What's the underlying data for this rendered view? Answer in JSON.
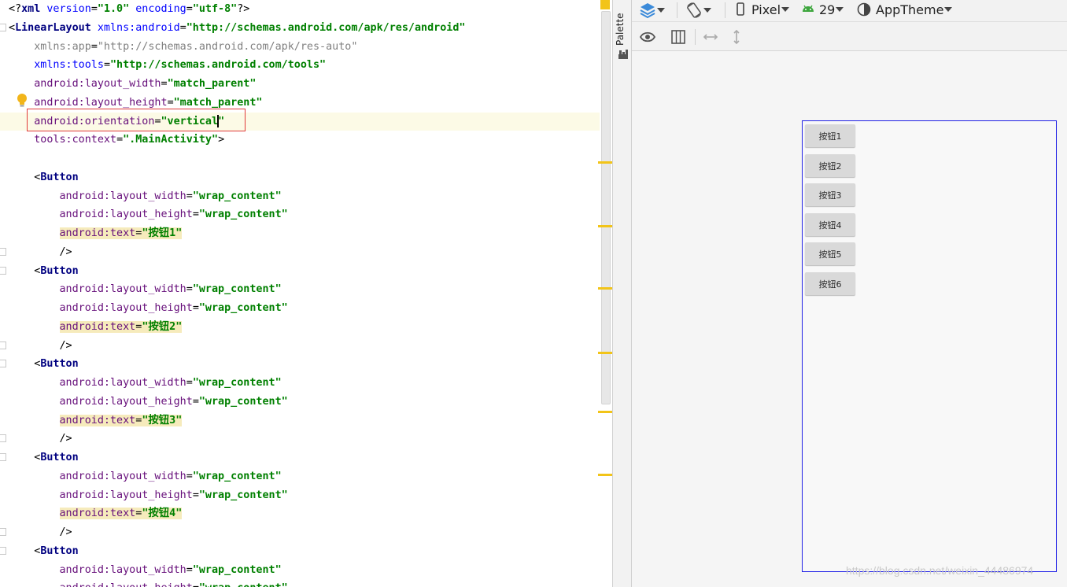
{
  "editor": {
    "lines": [
      {
        "parts": [
          [
            "punc",
            "<?"
          ],
          [
            "tag",
            "xml "
          ],
          [
            "attr-blue",
            "version"
          ],
          [
            "punc",
            "="
          ],
          [
            "val",
            "\"1.0\""
          ],
          [
            "punc",
            " "
          ],
          [
            "attr-blue",
            "encoding"
          ],
          [
            "punc",
            "="
          ],
          [
            "val",
            "\"utf-8\""
          ],
          [
            "punc",
            "?>"
          ]
        ]
      },
      {
        "parts": [
          [
            "punc",
            "<"
          ],
          [
            "tag",
            "LinearLayout "
          ],
          [
            "attr-blue",
            "xmlns:android"
          ],
          [
            "punc",
            "="
          ],
          [
            "val",
            "\"http://schemas.android.com/apk/res/android\""
          ]
        ]
      },
      {
        "parts": [
          [
            "punc",
            "    "
          ],
          [
            "attr-gray",
            "xmlns:app"
          ],
          [
            "punc",
            "="
          ],
          [
            "valg",
            "\"http://schemas.android.com/apk/res-auto\""
          ]
        ]
      },
      {
        "parts": [
          [
            "punc",
            "    "
          ],
          [
            "attr-blue",
            "xmlns:tools"
          ],
          [
            "punc",
            "="
          ],
          [
            "val",
            "\"http://schemas.android.com/tools\""
          ]
        ]
      },
      {
        "parts": [
          [
            "punc",
            "    "
          ],
          [
            "attr-ns",
            "android:layout_width"
          ],
          [
            "punc",
            "="
          ],
          [
            "val",
            "\"match_parent\""
          ]
        ]
      },
      {
        "parts": [
          [
            "punc",
            "    "
          ],
          [
            "attr-ns",
            "android:layout_height"
          ],
          [
            "punc",
            "="
          ],
          [
            "val",
            "\"match_parent\""
          ]
        ]
      },
      {
        "parts": [
          [
            "punc",
            "    "
          ],
          [
            "attr-ns",
            "android:orientation"
          ],
          [
            "punc",
            "="
          ],
          [
            "val",
            "\"vertical"
          ],
          [
            "caret",
            ""
          ],
          [
            "val",
            "\""
          ]
        ],
        "active": true
      },
      {
        "parts": [
          [
            "punc",
            "    "
          ],
          [
            "attr-ns",
            "tools:context"
          ],
          [
            "punc",
            "="
          ],
          [
            "val",
            "\".MainActivity\""
          ],
          [
            "punc",
            ">"
          ]
        ]
      },
      {
        "parts": []
      },
      {
        "parts": [
          [
            "punc",
            "    <"
          ],
          [
            "tag",
            "Button"
          ]
        ]
      },
      {
        "parts": [
          [
            "punc",
            "        "
          ],
          [
            "attr-ns",
            "android:layout_width"
          ],
          [
            "punc",
            "="
          ],
          [
            "val",
            "\"wrap_content\""
          ]
        ]
      },
      {
        "parts": [
          [
            "punc",
            "        "
          ],
          [
            "attr-ns",
            "android:layout_height"
          ],
          [
            "punc",
            "="
          ],
          [
            "val",
            "\"wrap_content\""
          ]
        ]
      },
      {
        "parts": [
          [
            "punc",
            "        "
          ],
          [
            "hl-attr",
            "android:text"
          ],
          [
            "hl-punc",
            "="
          ],
          [
            "hl-val",
            "\"按钮1\""
          ]
        ]
      },
      {
        "parts": [
          [
            "punc",
            "        />"
          ]
        ]
      },
      {
        "parts": [
          [
            "punc",
            "    <"
          ],
          [
            "tag",
            "Button"
          ]
        ]
      },
      {
        "parts": [
          [
            "punc",
            "        "
          ],
          [
            "attr-ns",
            "android:layout_width"
          ],
          [
            "punc",
            "="
          ],
          [
            "val",
            "\"wrap_content\""
          ]
        ]
      },
      {
        "parts": [
          [
            "punc",
            "        "
          ],
          [
            "attr-ns",
            "android:layout_height"
          ],
          [
            "punc",
            "="
          ],
          [
            "val",
            "\"wrap_content\""
          ]
        ]
      },
      {
        "parts": [
          [
            "punc",
            "        "
          ],
          [
            "hl-attr",
            "android:text"
          ],
          [
            "hl-punc",
            "="
          ],
          [
            "hl-val",
            "\"按钮2\""
          ]
        ]
      },
      {
        "parts": [
          [
            "punc",
            "        />"
          ]
        ]
      },
      {
        "parts": [
          [
            "punc",
            "    <"
          ],
          [
            "tag",
            "Button"
          ]
        ]
      },
      {
        "parts": [
          [
            "punc",
            "        "
          ],
          [
            "attr-ns",
            "android:layout_width"
          ],
          [
            "punc",
            "="
          ],
          [
            "val",
            "\"wrap_content\""
          ]
        ]
      },
      {
        "parts": [
          [
            "punc",
            "        "
          ],
          [
            "attr-ns",
            "android:layout_height"
          ],
          [
            "punc",
            "="
          ],
          [
            "val",
            "\"wrap_content\""
          ]
        ]
      },
      {
        "parts": [
          [
            "punc",
            "        "
          ],
          [
            "hl-attr",
            "android:text"
          ],
          [
            "hl-punc",
            "="
          ],
          [
            "hl-val",
            "\"按钮3\""
          ]
        ]
      },
      {
        "parts": [
          [
            "punc",
            "        />"
          ]
        ]
      },
      {
        "parts": [
          [
            "punc",
            "    <"
          ],
          [
            "tag",
            "Button"
          ]
        ]
      },
      {
        "parts": [
          [
            "punc",
            "        "
          ],
          [
            "attr-ns",
            "android:layout_width"
          ],
          [
            "punc",
            "="
          ],
          [
            "val",
            "\"wrap_content\""
          ]
        ]
      },
      {
        "parts": [
          [
            "punc",
            "        "
          ],
          [
            "attr-ns",
            "android:layout_height"
          ],
          [
            "punc",
            "="
          ],
          [
            "val",
            "\"wrap_content\""
          ]
        ]
      },
      {
        "parts": [
          [
            "punc",
            "        "
          ],
          [
            "hl-attr",
            "android:text"
          ],
          [
            "hl-punc",
            "="
          ],
          [
            "hl-val",
            "\"按钮4\""
          ]
        ]
      },
      {
        "parts": [
          [
            "punc",
            "        />"
          ]
        ]
      },
      {
        "parts": [
          [
            "punc",
            "    <"
          ],
          [
            "tag",
            "Button"
          ]
        ]
      },
      {
        "parts": [
          [
            "punc",
            "        "
          ],
          [
            "attr-ns",
            "android:layout_width"
          ],
          [
            "punc",
            "="
          ],
          [
            "val",
            "\"wrap_content\""
          ]
        ]
      },
      {
        "parts": [
          [
            "punc",
            "        "
          ],
          [
            "attr-ns",
            "android:layout_height"
          ],
          [
            "punc",
            "="
          ],
          [
            "val",
            "\"wrap_content\""
          ]
        ]
      }
    ]
  },
  "palette": {
    "label": "Palette",
    "icon": "palette-icon"
  },
  "toolbar": {
    "design_surface_icon": "layers-icon",
    "orientation_icon": "rotate-icon",
    "device_icon": "phone-icon",
    "device_label": "Pixel",
    "api_icon": "android-icon",
    "api_label": "29",
    "theme_icon": "theme-icon",
    "theme_label": "AppTheme",
    "view_options_icon": "eye-icon",
    "layout_icon": "columns-icon",
    "expand_h_icon": "expand-horizontal-icon",
    "expand_v_icon": "expand-vertical-icon"
  },
  "preview": {
    "buttons": [
      "按钮1",
      "按钮2",
      "按钮3",
      "按钮4",
      "按钮5",
      "按钮6"
    ]
  },
  "watermark": "https://blog.csdn.net/weixin_44486974",
  "colors": {
    "accent_frame": "#2020e6",
    "marker": "#f2c418",
    "error_box": "#e03a3a"
  }
}
